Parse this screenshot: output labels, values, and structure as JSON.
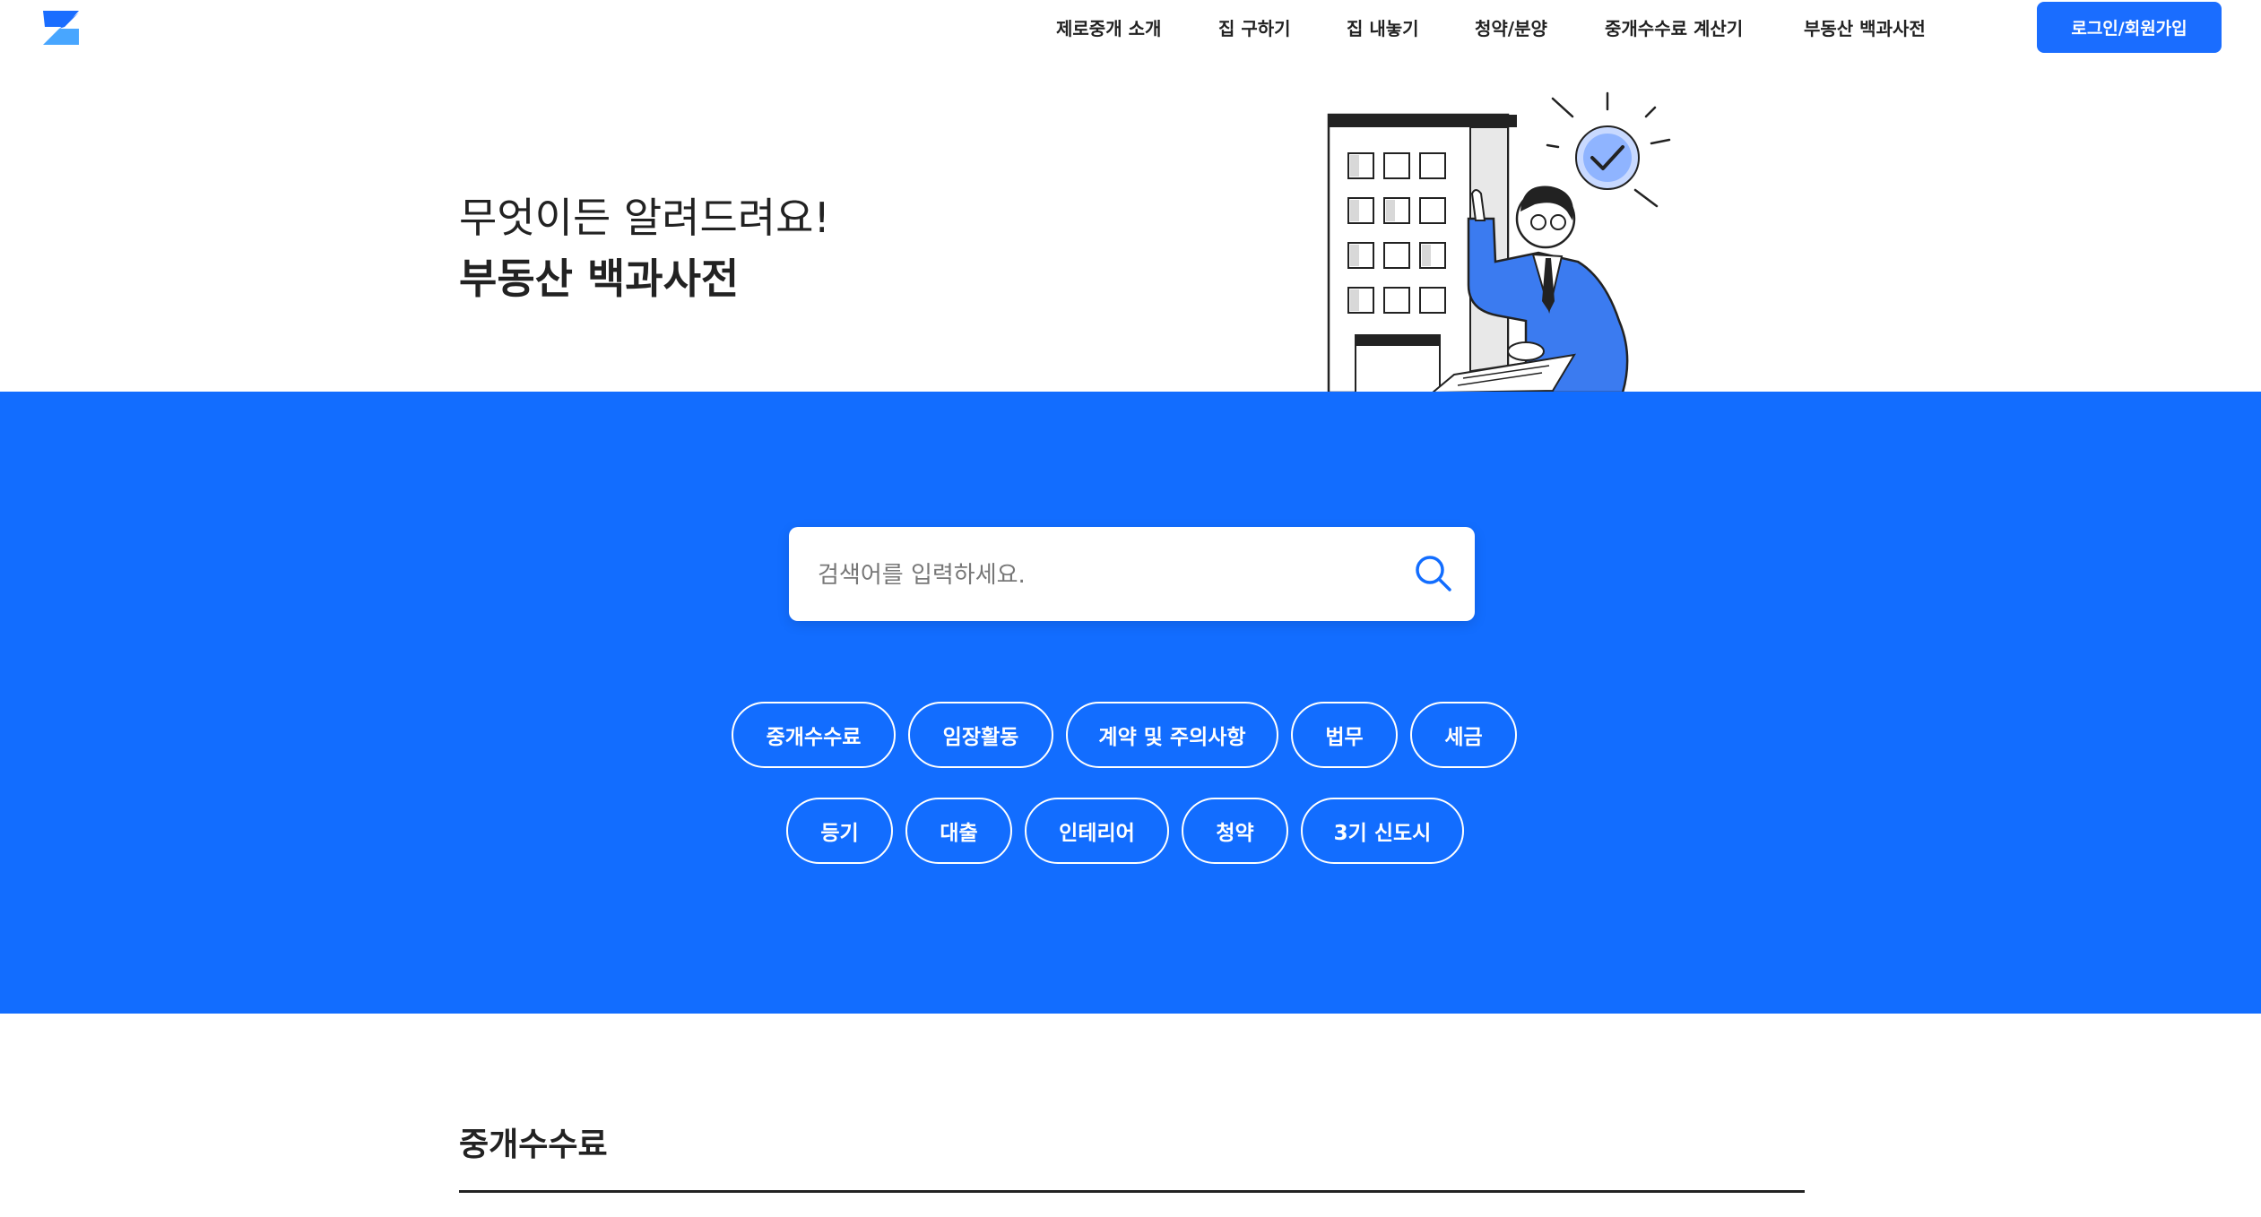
{
  "nav": {
    "items": [
      "제로중개 소개",
      "집 구하기",
      "집 내놓기",
      "청약/분양",
      "중개수수료 계산기",
      "부동산 백과사전"
    ],
    "login_label": "로그인/회원가입"
  },
  "hero": {
    "line1": "무엇이든 알려드려요!",
    "line2": "부동산 백과사전"
  },
  "search": {
    "placeholder": "검색어를 입력하세요."
  },
  "categories": {
    "row1": [
      "중개수수료",
      "임장활동",
      "계약 및 주의사항",
      "법무",
      "세금"
    ],
    "row2": [
      "등기",
      "대출",
      "인테리어",
      "청약",
      "3기 신도시"
    ]
  },
  "section": {
    "title": "중개수수료"
  },
  "colors": {
    "brand_blue": "#126dff",
    "button_blue": "#1a6dff"
  },
  "icons": [
    "logo-icon",
    "search-icon"
  ]
}
